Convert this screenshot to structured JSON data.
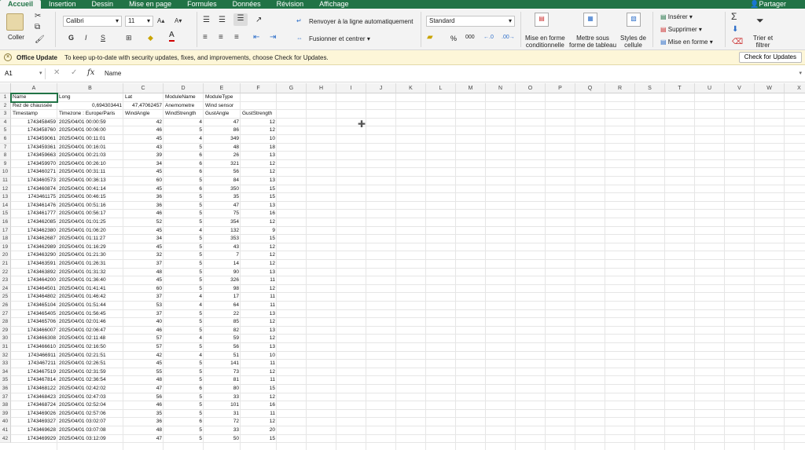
{
  "tabs": [
    "Accueil",
    "Insertion",
    "Dessin",
    "Mise en page",
    "Formules",
    "Données",
    "Révision",
    "Affichage"
  ],
  "share": "Partager",
  "ribbon": {
    "paste": "Coller",
    "font": "Calibri",
    "size": "11",
    "bold": "G",
    "italic": "I",
    "underline": "S",
    "wrap": "Renvoyer à la ligne automatiquement",
    "merge": "Fusionner et centrer",
    "number_format": "Standard",
    "percent": "%",
    "thousands": "000",
    "cond_format": [
      "Mise en forme",
      "conditionnelle"
    ],
    "format_table": [
      "Mettre sous",
      "forme de tableau"
    ],
    "cell_styles": [
      "Styles de",
      "cellule"
    ],
    "insert": "Insérer",
    "delete": "Supprimer",
    "format": "Mise en forme",
    "sort_filter": [
      "Trier et",
      "filtrer"
    ]
  },
  "notification": {
    "title": "Office Update",
    "message": "To keep up-to-date with security updates, fixes, and improvements, choose Check for Updates.",
    "button": "Check for Updates"
  },
  "formula_bar": {
    "name_box": "A1",
    "cancel": "✕",
    "enter": "✓",
    "fx": "fx",
    "content": "Name"
  },
  "columns": [
    "A",
    "B",
    "C",
    "D",
    "E",
    "F",
    "G",
    "H",
    "I",
    "J",
    "K",
    "L",
    "M",
    "N",
    "O",
    "P",
    "Q",
    "R",
    "S",
    "T",
    "U",
    "V",
    "W",
    "X"
  ],
  "header_rows": [
    [
      "Name",
      "Long",
      "Lat",
      "ModuleName",
      "ModuleType",
      ""
    ],
    [
      "Rez de chaussée",
      "0,694303441",
      "47,47062457",
      "Anemometre",
      "Wind sensor",
      ""
    ],
    [
      "Timestamp",
      "Timezone : Europe/Paris",
      "WindAngle",
      "WindStrength",
      "GustAngle",
      "GustStrength"
    ]
  ],
  "data_rows": [
    [
      "1743458459",
      "2025/04/01 00:00:59",
      "42",
      "4",
      "47",
      "12"
    ],
    [
      "1743458760",
      "2025/04/01 00:06:00",
      "46",
      "5",
      "86",
      "12"
    ],
    [
      "1743459061",
      "2025/04/01 00:11:01",
      "45",
      "4",
      "349",
      "10"
    ],
    [
      "1743459361",
      "2025/04/01 00:16:01",
      "43",
      "5",
      "48",
      "18"
    ],
    [
      "1743459663",
      "2025/04/01 00:21:03",
      "39",
      "6",
      "26",
      "13"
    ],
    [
      "1743459970",
      "2025/04/01 00:26:10",
      "34",
      "6",
      "321",
      "12"
    ],
    [
      "1743460271",
      "2025/04/01 00:31:11",
      "45",
      "6",
      "56",
      "12"
    ],
    [
      "1743460573",
      "2025/04/01 00:36:13",
      "60",
      "5",
      "84",
      "13"
    ],
    [
      "1743460874",
      "2025/04/01 00:41:14",
      "45",
      "6",
      "350",
      "15"
    ],
    [
      "1743461175",
      "2025/04/01 00:46:15",
      "36",
      "5",
      "35",
      "15"
    ],
    [
      "1743461476",
      "2025/04/01 00:51:16",
      "36",
      "5",
      "47",
      "13"
    ],
    [
      "1743461777",
      "2025/04/01 00:56:17",
      "46",
      "5",
      "75",
      "16"
    ],
    [
      "1743462085",
      "2025/04/01 01:01:25",
      "52",
      "5",
      "354",
      "12"
    ],
    [
      "1743462380",
      "2025/04/01 01:06:20",
      "45",
      "4",
      "132",
      "9"
    ],
    [
      "1743462687",
      "2025/04/01 01:11:27",
      "34",
      "5",
      "353",
      "15"
    ],
    [
      "1743462989",
      "2025/04/01 01:16:29",
      "45",
      "5",
      "43",
      "12"
    ],
    [
      "1743463290",
      "2025/04/01 01:21:30",
      "32",
      "5",
      "7",
      "12"
    ],
    [
      "1743463591",
      "2025/04/01 01:26:31",
      "37",
      "5",
      "14",
      "12"
    ],
    [
      "1743463892",
      "2025/04/01 01:31:32",
      "48",
      "5",
      "90",
      "13"
    ],
    [
      "1743464200",
      "2025/04/01 01:36:40",
      "45",
      "5",
      "326",
      "11"
    ],
    [
      "1743464501",
      "2025/04/01 01:41:41",
      "60",
      "5",
      "98",
      "12"
    ],
    [
      "1743464802",
      "2025/04/01 01:46:42",
      "37",
      "4",
      "17",
      "11"
    ],
    [
      "1743465104",
      "2025/04/01 01:51:44",
      "53",
      "4",
      "64",
      "11"
    ],
    [
      "1743465405",
      "2025/04/01 01:56:45",
      "37",
      "5",
      "22",
      "13"
    ],
    [
      "1743465706",
      "2025/04/01 02:01:46",
      "40",
      "5",
      "85",
      "12"
    ],
    [
      "1743466007",
      "2025/04/01 02:06:47",
      "46",
      "5",
      "82",
      "13"
    ],
    [
      "1743466308",
      "2025/04/01 02:11:48",
      "57",
      "4",
      "59",
      "12"
    ],
    [
      "1743466610",
      "2025/04/01 02:16:50",
      "57",
      "5",
      "56",
      "13"
    ],
    [
      "1743466911",
      "2025/04/01 02:21:51",
      "42",
      "4",
      "51",
      "10"
    ],
    [
      "1743467211",
      "2025/04/01 02:26:51",
      "45",
      "5",
      "141",
      "11"
    ],
    [
      "1743467519",
      "2025/04/01 02:31:59",
      "55",
      "5",
      "73",
      "12"
    ],
    [
      "1743467814",
      "2025/04/01 02:36:54",
      "48",
      "5",
      "81",
      "11"
    ],
    [
      "1743468122",
      "2025/04/01 02:42:02",
      "47",
      "6",
      "80",
      "15"
    ],
    [
      "1743468423",
      "2025/04/01 02:47:03",
      "56",
      "5",
      "33",
      "12"
    ],
    [
      "1743468724",
      "2025/04/01 02:52:04",
      "46",
      "5",
      "101",
      "16"
    ],
    [
      "1743469026",
      "2025/04/01 02:57:06",
      "35",
      "5",
      "31",
      "11"
    ],
    [
      "1743469327",
      "2025/04/01 03:02:07",
      "36",
      "6",
      "72",
      "12"
    ],
    [
      "1743469628",
      "2025/04/01 03:07:08",
      "48",
      "5",
      "33",
      "20"
    ],
    [
      "1743469929",
      "2025/04/01 03:12:09",
      "47",
      "5",
      "50",
      "15"
    ]
  ]
}
